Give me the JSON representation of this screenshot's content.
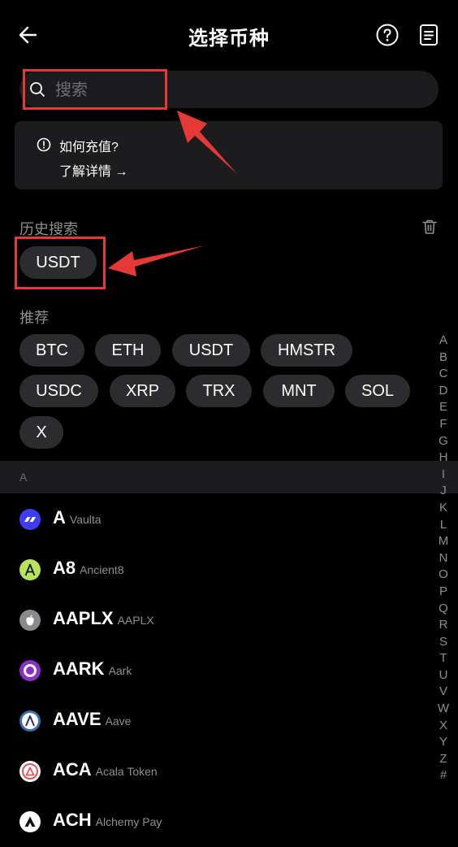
{
  "header": {
    "title": "选择币种",
    "back_icon": "arrow-left-icon",
    "help_icon": "help-circle-icon",
    "orders_icon": "document-icon"
  },
  "search": {
    "placeholder": "搜索",
    "value": ""
  },
  "info": {
    "title": "如何充值?",
    "link": "了解详情"
  },
  "history": {
    "label": "历史搜索",
    "items": [
      "USDT"
    ]
  },
  "recommend": {
    "label": "推荐",
    "items": [
      "BTC",
      "ETH",
      "USDT",
      "HMSTR",
      "USDC",
      "XRP",
      "TRX",
      "MNT",
      "SOL",
      "X"
    ]
  },
  "group": {
    "letter": "A"
  },
  "coins": [
    {
      "symbol": "A",
      "name": "Vaulta",
      "color": "#3d3df5"
    },
    {
      "symbol": "A8",
      "name": "Ancient8",
      "color": "#b6e55c"
    },
    {
      "symbol": "AAPLX",
      "name": "AAPLX",
      "color": "#8a8a8e"
    },
    {
      "symbol": "AARK",
      "name": "Aark",
      "color": "#8b2fc9"
    },
    {
      "symbol": "AAVE",
      "name": "Aave",
      "color": "#3b6ea8"
    },
    {
      "symbol": "ACA",
      "name": "Acala Token",
      "color": "#e8505b"
    },
    {
      "symbol": "ACH",
      "name": "Alchemy Pay",
      "color": "#ffffff"
    }
  ],
  "alphabet": [
    "A",
    "B",
    "C",
    "D",
    "E",
    "F",
    "G",
    "H",
    "I",
    "J",
    "K",
    "L",
    "M",
    "N",
    "O",
    "P",
    "Q",
    "R",
    "S",
    "T",
    "U",
    "V",
    "W",
    "X",
    "Y",
    "Z",
    "#"
  ],
  "colors": {
    "background": "#000000",
    "card": "#1c1c1e",
    "chip": "#2c2c2e",
    "highlight": "#e53935"
  }
}
